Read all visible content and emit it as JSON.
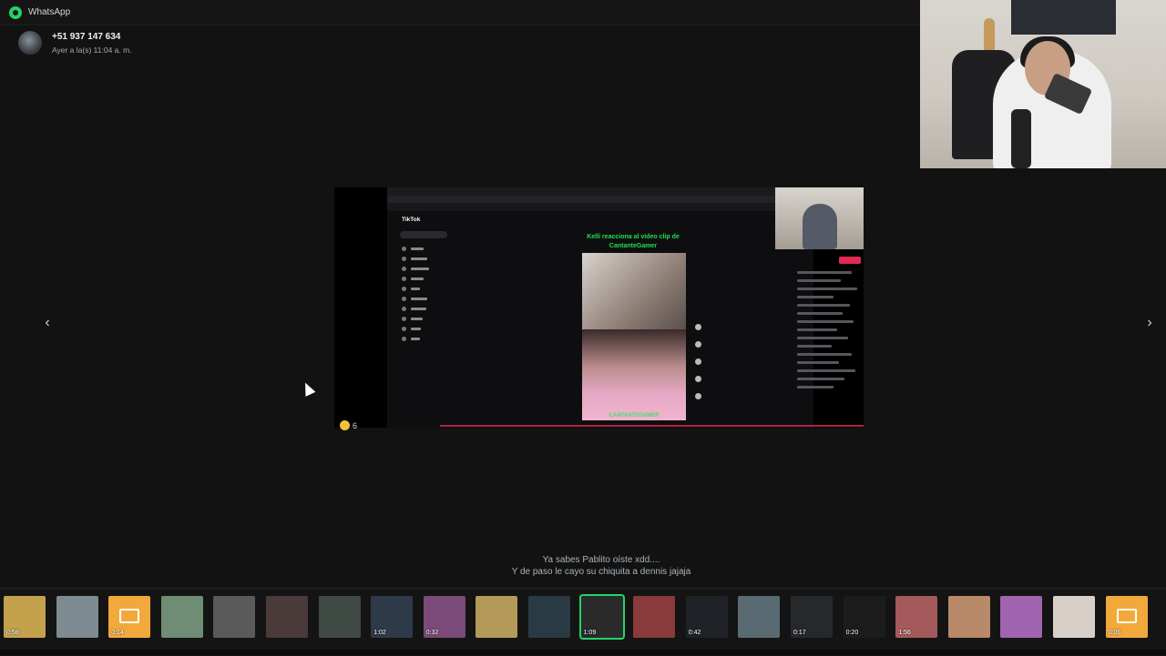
{
  "app": {
    "title": "WhatsApp"
  },
  "sender": {
    "name": "+51 937 147 634",
    "time": "Ayer a la(s) 11:04 a. m."
  },
  "media": {
    "tiktok_label": "TikTok",
    "overlay_title": "Kelli reacciona al video clip de CantanteGamer",
    "overlay_label": "CANTANTEGAMER",
    "reaction_count": "6",
    "colors": {
      "accent": "#25d366",
      "tiktok_red": "#e22a52",
      "title_green": "#1ee04a"
    }
  },
  "caption": {
    "line1": "Ya sabes Pablito oíste xdd....",
    "line2": "Y de paso le cayo su chiquita a dennis jajaja"
  },
  "navigation": {
    "prev_icon": "chevron-left-icon",
    "next_icon": "chevron-right-icon"
  },
  "thumbnails": [
    {
      "duration": "0:58",
      "kind": "video",
      "color": "#c4a24d"
    },
    {
      "duration": "",
      "kind": "image",
      "color": "#7d8a91"
    },
    {
      "duration": "0:14",
      "kind": "audio",
      "color": "#f2a93b"
    },
    {
      "duration": "",
      "kind": "image",
      "color": "#6e8d74"
    },
    {
      "duration": "",
      "kind": "image",
      "color": "#5a5a5a"
    },
    {
      "duration": "",
      "kind": "image",
      "color": "#4a3a3a"
    },
    {
      "duration": "",
      "kind": "video",
      "color": "#3f4a44"
    },
    {
      "duration": "1:02",
      "kind": "video",
      "color": "#2e3a4a"
    },
    {
      "duration": "0:32",
      "kind": "video",
      "color": "#7a4a78"
    },
    {
      "duration": "",
      "kind": "image",
      "color": "#b39a5a"
    },
    {
      "duration": "",
      "kind": "image",
      "color": "#2a3a44"
    },
    {
      "duration": "1:09",
      "kind": "video",
      "color": "#2b2b2b",
      "selected": true
    },
    {
      "duration": "",
      "kind": "image",
      "color": "#8a3a3a"
    },
    {
      "duration": "0:42",
      "kind": "video",
      "color": "#1f2328"
    },
    {
      "duration": "",
      "kind": "image",
      "color": "#5a6a73"
    },
    {
      "duration": "0:17",
      "kind": "video",
      "color": "#26292c"
    },
    {
      "duration": "0:20",
      "kind": "video",
      "color": "#1c1c1c"
    },
    {
      "duration": "1:56",
      "kind": "video",
      "color": "#a45a5a"
    },
    {
      "duration": "",
      "kind": "image",
      "color": "#b88a6a"
    },
    {
      "duration": "",
      "kind": "image",
      "color": "#a064b0"
    },
    {
      "duration": "",
      "kind": "image",
      "color": "#d8cfc8"
    },
    {
      "duration": "0:06",
      "kind": "audio",
      "color": "#f2a93b"
    }
  ]
}
